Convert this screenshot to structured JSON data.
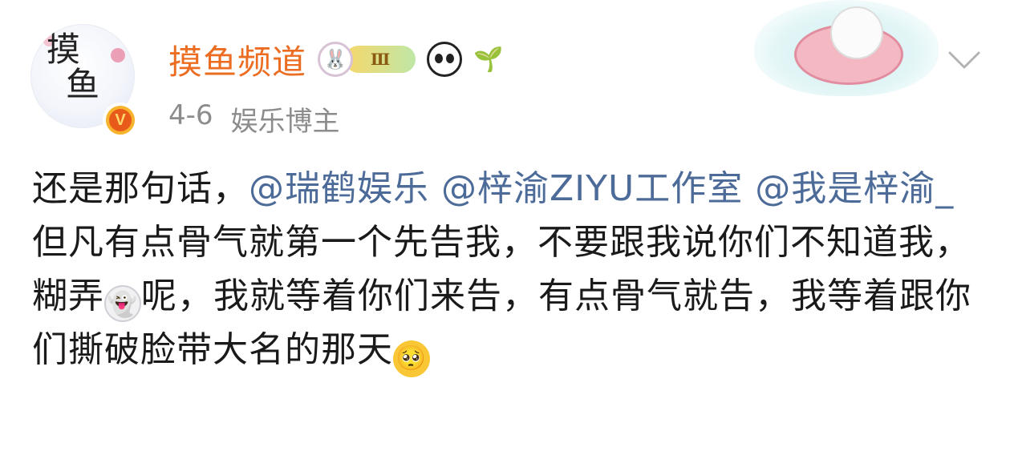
{
  "post": {
    "author": {
      "avatar_text": "摸鱼",
      "username": "摸鱼频道",
      "verified_symbol": "V",
      "rank_badge_text": "Ⅲ"
    },
    "meta": {
      "date": "4-6",
      "role": "娱乐博主"
    },
    "body": {
      "t1": "还是那句话，",
      "mention1": "@瑞鹤娱乐",
      "mention2": "@梓渝ZIYU工作室",
      "mention3": "@我是梓渝_",
      "t2": " 但凡有点骨气就第一个先告我，不要跟我说你们不知道我，糊弄",
      "t3": "呢，我就等着你们来告，有点骨气就告，我等着跟你们撕破脸带大名的那天"
    },
    "icons": {
      "ghost_emoji": "👻",
      "pleading_emoji": "🥺",
      "rabbit_badge": "🐰",
      "sprout_badge": "🌱"
    },
    "colors": {
      "username": "#ec6d21",
      "mention": "#4d6b99",
      "meta": "#8c8c8c",
      "verified": "#f7b32b"
    }
  }
}
